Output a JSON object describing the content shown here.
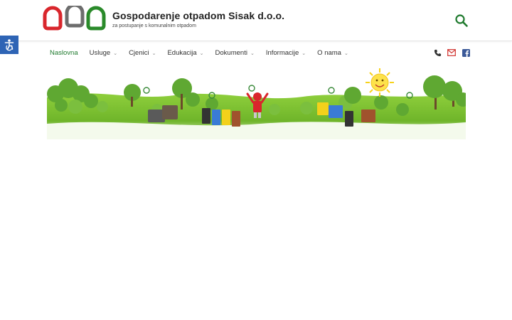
{
  "site": {
    "title": "Gospodarenje otpadom Sisak d.o.o.",
    "tagline": "za postupanje s komunalnim otpadom"
  },
  "nav": {
    "items": [
      {
        "label": "Naslovna",
        "active": true,
        "has_submenu": false
      },
      {
        "label": "Usluge",
        "active": false,
        "has_submenu": true
      },
      {
        "label": "Cjenici",
        "active": false,
        "has_submenu": true
      },
      {
        "label": "Edukacija",
        "active": false,
        "has_submenu": true
      },
      {
        "label": "Dokumenti",
        "active": false,
        "has_submenu": true
      },
      {
        "label": "Informacije",
        "active": false,
        "has_submenu": true
      },
      {
        "label": "O nama",
        "active": false,
        "has_submenu": true
      }
    ],
    "submenu_chevron": "⌄"
  },
  "icons": {
    "search": "search-icon",
    "accessibility": "accessibility-icon",
    "phone": "phone-icon",
    "email": "email-icon",
    "facebook": "facebook-icon"
  },
  "colors": {
    "brand_green": "#1f7a2e",
    "accessibility_blue": "#2e64b5",
    "facebook_blue": "#3b5998",
    "email_red": "#d0312d",
    "logo_red": "#d9262c",
    "logo_gray": "#6d6d6d",
    "logo_green": "#2a8a2a"
  }
}
